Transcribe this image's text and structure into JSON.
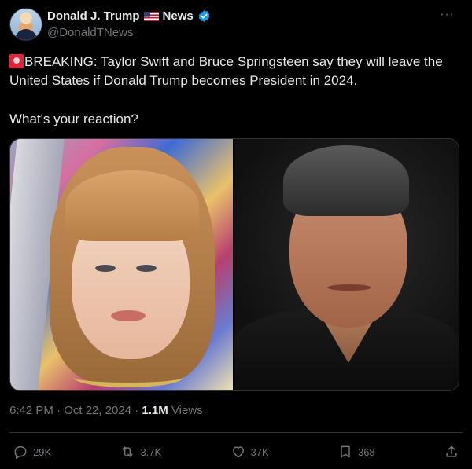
{
  "author": {
    "display_name": "Donald J. Trump",
    "flag_icon": "us-flag-icon",
    "news_label": "News",
    "verified_icon": "verified-badge-icon",
    "handle": "@DonaldTNews"
  },
  "tweet": {
    "siren_icon": "rotating-light-icon",
    "text": "BREAKING: Taylor Swift and Bruce Springsteen say they will leave the United States if Donald Trump becomes President in 2024.",
    "reaction_text": "What's your reaction?"
  },
  "meta": {
    "time_date": "6:42 PM · Oct 22, 2024 · ",
    "views_count": "1.1M",
    "views_label": " Views"
  },
  "actions": {
    "replies": "29K",
    "reposts": "3.7K",
    "likes": "37K",
    "bookmarks": "368"
  },
  "colors": {
    "background": "#000000",
    "text": "#e7e9ea",
    "muted": "#71767b",
    "verified": "#1d9bf0",
    "siren": "#e0243a"
  }
}
